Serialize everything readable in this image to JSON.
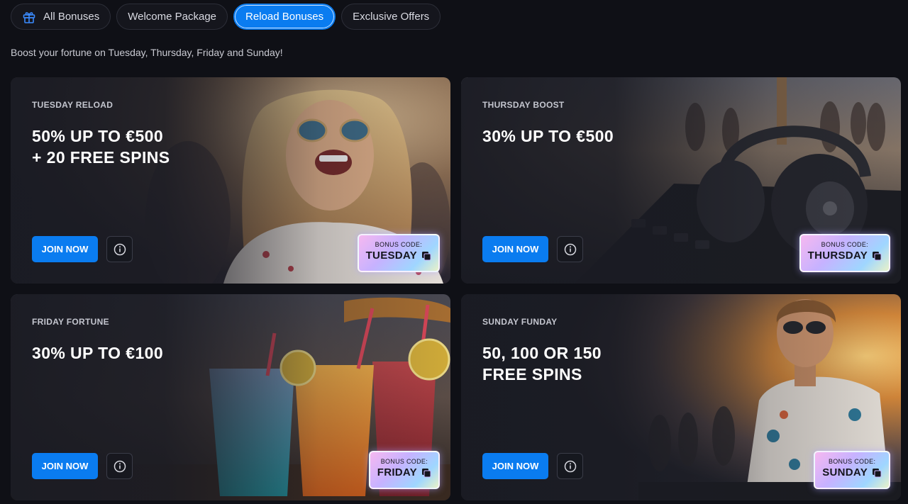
{
  "tabs": [
    {
      "label": "All Bonuses",
      "icon": "gift-icon",
      "active": false
    },
    {
      "label": "Welcome Package",
      "active": false
    },
    {
      "label": "Reload Bonuses",
      "active": true
    },
    {
      "label": "Exclusive Offers",
      "active": false
    }
  ],
  "subtitle": "Boost your fortune on Tuesday, Thursday, Friday and Sunday!",
  "cards": [
    {
      "label": "TUESDAY RELOAD",
      "line1": "50% UP TO €500",
      "line2": "+ 20 FREE SPINS",
      "join": "JOIN NOW",
      "code_title": "BONUS CODE:",
      "code": "TUESDAY"
    },
    {
      "label": "THURSDAY BOOST",
      "line1": "30% UP TO €500",
      "line2": "",
      "join": "JOIN NOW",
      "code_title": "BONUS CODE:",
      "code": "THURSDAY"
    },
    {
      "label": "FRIDAY FORTUNE",
      "line1": "30% UP TO €100",
      "line2": "",
      "join": "JOIN NOW",
      "code_title": "BONUS CODE:",
      "code": "FRIDAY"
    },
    {
      "label": "SUNDAY FUNDAY",
      "line1": "50, 100 OR 150",
      "line2": "FREE SPINS",
      "join": "JOIN NOW",
      "code_title": "BONUS CODE:",
      "code": "SUNDAY"
    }
  ],
  "colors": {
    "accent": "#0a7cf0",
    "background": "#0f1016",
    "card": "#1a1b23"
  }
}
